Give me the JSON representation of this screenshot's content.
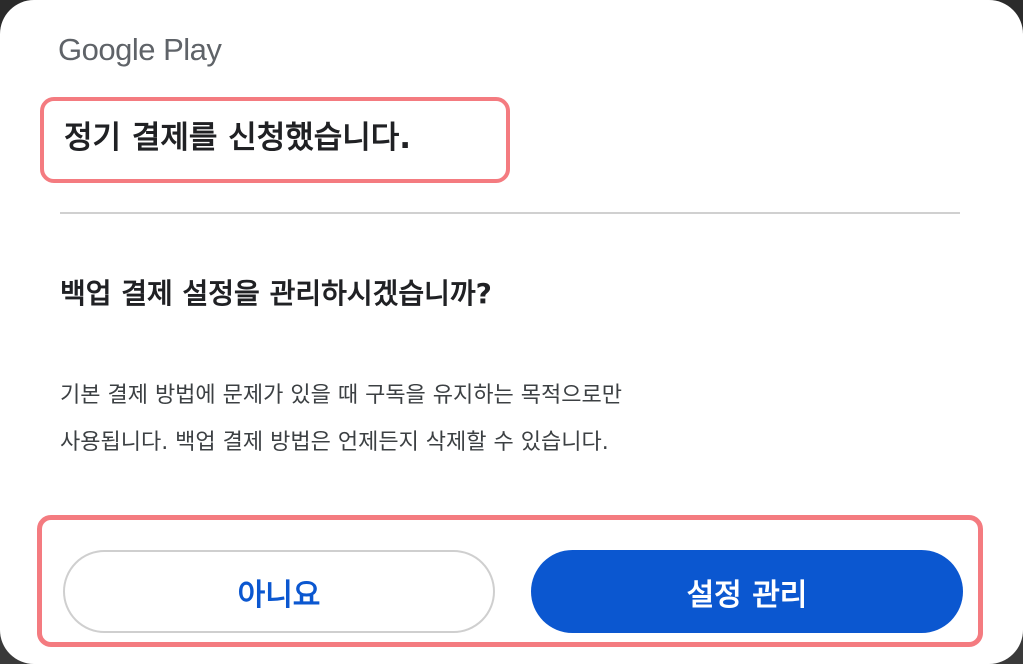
{
  "dialog": {
    "brand": "Google Play",
    "title": "정기 결제를 신청했습니다.",
    "question": "백업 결제 설정을 관리하시겠습니까?",
    "body_lines": [
      "기본 결제 방법에 문제가 있을 때 구독을 유지하는 목적으로만",
      "사용됩니다. 백업 결제 방법은 언제든지 삭제할 수 있습니다."
    ],
    "buttons": {
      "no": "아니요",
      "manage": "설정 관리"
    }
  },
  "colors": {
    "accent": "#0b57d0",
    "highlight": "#f47b80",
    "brand_text": "#5f6368"
  }
}
